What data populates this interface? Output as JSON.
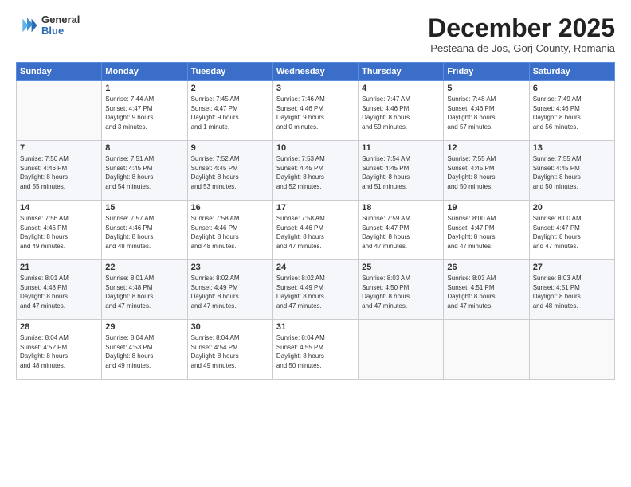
{
  "logo": {
    "general": "General",
    "blue": "Blue"
  },
  "title": "December 2025",
  "subtitle": "Pesteana de Jos, Gorj County, Romania",
  "header_days": [
    "Sunday",
    "Monday",
    "Tuesday",
    "Wednesday",
    "Thursday",
    "Friday",
    "Saturday"
  ],
  "weeks": [
    [
      {
        "day": "",
        "info": ""
      },
      {
        "day": "1",
        "info": "Sunrise: 7:44 AM\nSunset: 4:47 PM\nDaylight: 9 hours\nand 3 minutes."
      },
      {
        "day": "2",
        "info": "Sunrise: 7:45 AM\nSunset: 4:47 PM\nDaylight: 9 hours\nand 1 minute."
      },
      {
        "day": "3",
        "info": "Sunrise: 7:46 AM\nSunset: 4:46 PM\nDaylight: 9 hours\nand 0 minutes."
      },
      {
        "day": "4",
        "info": "Sunrise: 7:47 AM\nSunset: 4:46 PM\nDaylight: 8 hours\nand 59 minutes."
      },
      {
        "day": "5",
        "info": "Sunrise: 7:48 AM\nSunset: 4:46 PM\nDaylight: 8 hours\nand 57 minutes."
      },
      {
        "day": "6",
        "info": "Sunrise: 7:49 AM\nSunset: 4:46 PM\nDaylight: 8 hours\nand 56 minutes."
      }
    ],
    [
      {
        "day": "7",
        "info": "Sunrise: 7:50 AM\nSunset: 4:46 PM\nDaylight: 8 hours\nand 55 minutes."
      },
      {
        "day": "8",
        "info": "Sunrise: 7:51 AM\nSunset: 4:45 PM\nDaylight: 8 hours\nand 54 minutes."
      },
      {
        "day": "9",
        "info": "Sunrise: 7:52 AM\nSunset: 4:45 PM\nDaylight: 8 hours\nand 53 minutes."
      },
      {
        "day": "10",
        "info": "Sunrise: 7:53 AM\nSunset: 4:45 PM\nDaylight: 8 hours\nand 52 minutes."
      },
      {
        "day": "11",
        "info": "Sunrise: 7:54 AM\nSunset: 4:45 PM\nDaylight: 8 hours\nand 51 minutes."
      },
      {
        "day": "12",
        "info": "Sunrise: 7:55 AM\nSunset: 4:45 PM\nDaylight: 8 hours\nand 50 minutes."
      },
      {
        "day": "13",
        "info": "Sunrise: 7:55 AM\nSunset: 4:45 PM\nDaylight: 8 hours\nand 50 minutes."
      }
    ],
    [
      {
        "day": "14",
        "info": "Sunrise: 7:56 AM\nSunset: 4:46 PM\nDaylight: 8 hours\nand 49 minutes."
      },
      {
        "day": "15",
        "info": "Sunrise: 7:57 AM\nSunset: 4:46 PM\nDaylight: 8 hours\nand 48 minutes."
      },
      {
        "day": "16",
        "info": "Sunrise: 7:58 AM\nSunset: 4:46 PM\nDaylight: 8 hours\nand 48 minutes."
      },
      {
        "day": "17",
        "info": "Sunrise: 7:58 AM\nSunset: 4:46 PM\nDaylight: 8 hours\nand 47 minutes."
      },
      {
        "day": "18",
        "info": "Sunrise: 7:59 AM\nSunset: 4:47 PM\nDaylight: 8 hours\nand 47 minutes."
      },
      {
        "day": "19",
        "info": "Sunrise: 8:00 AM\nSunset: 4:47 PM\nDaylight: 8 hours\nand 47 minutes."
      },
      {
        "day": "20",
        "info": "Sunrise: 8:00 AM\nSunset: 4:47 PM\nDaylight: 8 hours\nand 47 minutes."
      }
    ],
    [
      {
        "day": "21",
        "info": "Sunrise: 8:01 AM\nSunset: 4:48 PM\nDaylight: 8 hours\nand 47 minutes."
      },
      {
        "day": "22",
        "info": "Sunrise: 8:01 AM\nSunset: 4:48 PM\nDaylight: 8 hours\nand 47 minutes."
      },
      {
        "day": "23",
        "info": "Sunrise: 8:02 AM\nSunset: 4:49 PM\nDaylight: 8 hours\nand 47 minutes."
      },
      {
        "day": "24",
        "info": "Sunrise: 8:02 AM\nSunset: 4:49 PM\nDaylight: 8 hours\nand 47 minutes."
      },
      {
        "day": "25",
        "info": "Sunrise: 8:03 AM\nSunset: 4:50 PM\nDaylight: 8 hours\nand 47 minutes."
      },
      {
        "day": "26",
        "info": "Sunrise: 8:03 AM\nSunset: 4:51 PM\nDaylight: 8 hours\nand 47 minutes."
      },
      {
        "day": "27",
        "info": "Sunrise: 8:03 AM\nSunset: 4:51 PM\nDaylight: 8 hours\nand 48 minutes."
      }
    ],
    [
      {
        "day": "28",
        "info": "Sunrise: 8:04 AM\nSunset: 4:52 PM\nDaylight: 8 hours\nand 48 minutes."
      },
      {
        "day": "29",
        "info": "Sunrise: 8:04 AM\nSunset: 4:53 PM\nDaylight: 8 hours\nand 49 minutes."
      },
      {
        "day": "30",
        "info": "Sunrise: 8:04 AM\nSunset: 4:54 PM\nDaylight: 8 hours\nand 49 minutes."
      },
      {
        "day": "31",
        "info": "Sunrise: 8:04 AM\nSunset: 4:55 PM\nDaylight: 8 hours\nand 50 minutes."
      },
      {
        "day": "",
        "info": ""
      },
      {
        "day": "",
        "info": ""
      },
      {
        "day": "",
        "info": ""
      }
    ]
  ]
}
